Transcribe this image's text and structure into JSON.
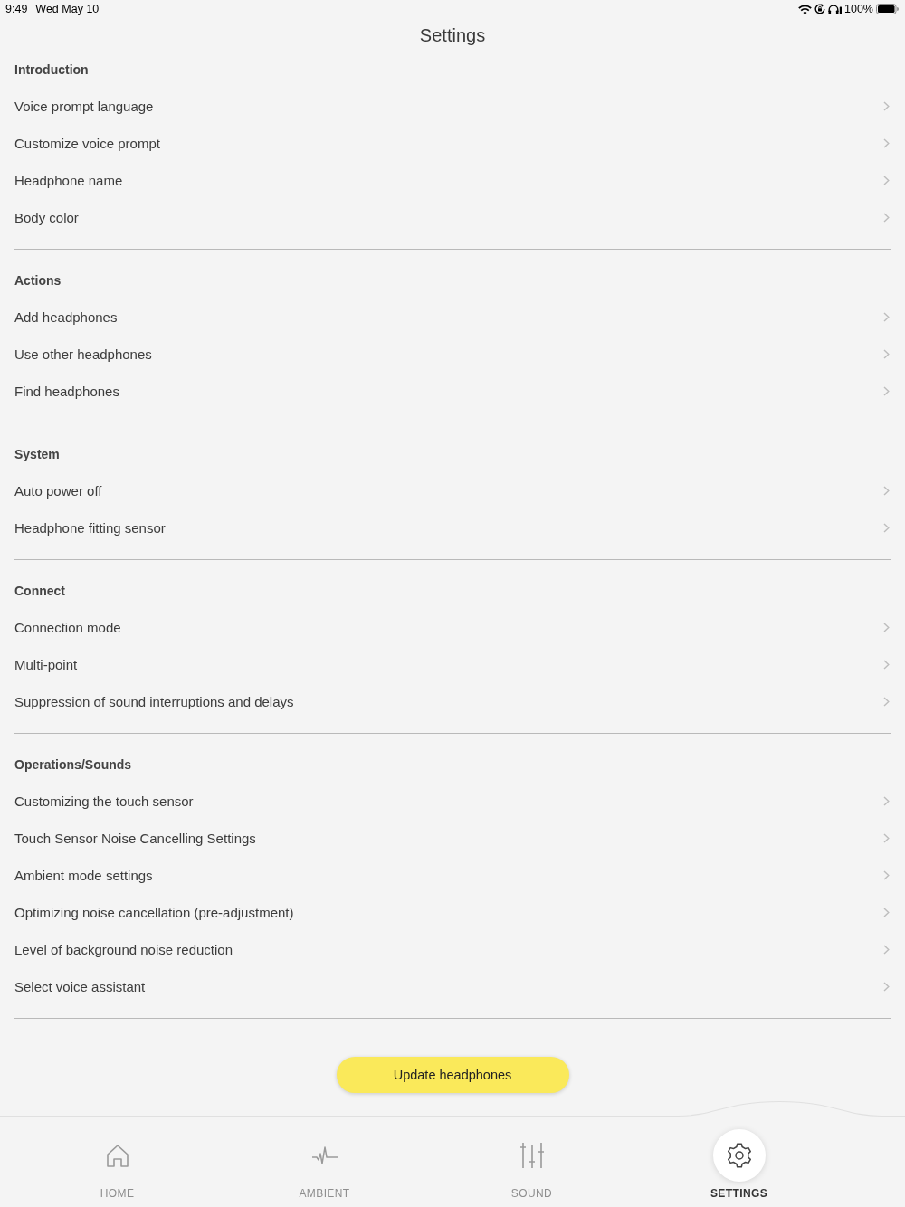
{
  "status_bar": {
    "time": "9:49",
    "date": "Wed May 10",
    "battery_percent": "100%"
  },
  "title": "Settings",
  "sections": [
    {
      "header": "Introduction",
      "items": [
        {
          "label": "Voice prompt language"
        },
        {
          "label": "Customize voice prompt"
        },
        {
          "label": "Headphone name"
        },
        {
          "label": "Body color"
        }
      ]
    },
    {
      "header": "Actions",
      "items": [
        {
          "label": "Add headphones"
        },
        {
          "label": "Use other headphones"
        },
        {
          "label": "Find headphones"
        }
      ]
    },
    {
      "header": "System",
      "items": [
        {
          "label": "Auto power off"
        },
        {
          "label": "Headphone fitting sensor"
        }
      ]
    },
    {
      "header": "Connect",
      "items": [
        {
          "label": "Connection mode"
        },
        {
          "label": "Multi-point"
        },
        {
          "label": "Suppression of sound interruptions and delays"
        }
      ]
    },
    {
      "header": "Operations/Sounds",
      "items": [
        {
          "label": "Customizing the touch sensor"
        },
        {
          "label": "Touch Sensor Noise Cancelling Settings"
        },
        {
          "label": "Ambient mode settings"
        },
        {
          "label": "Optimizing noise cancellation (pre-adjustment)"
        },
        {
          "label": "Level of background noise reduction"
        },
        {
          "label": "Select voice assistant"
        }
      ]
    }
  ],
  "update_button": "Update headphones",
  "tab_bar": [
    {
      "label": "HOME",
      "selected": false
    },
    {
      "label": "AMBIENT",
      "selected": false
    },
    {
      "label": "SOUND",
      "selected": false
    },
    {
      "label": "SETTINGS",
      "selected": true
    }
  ]
}
